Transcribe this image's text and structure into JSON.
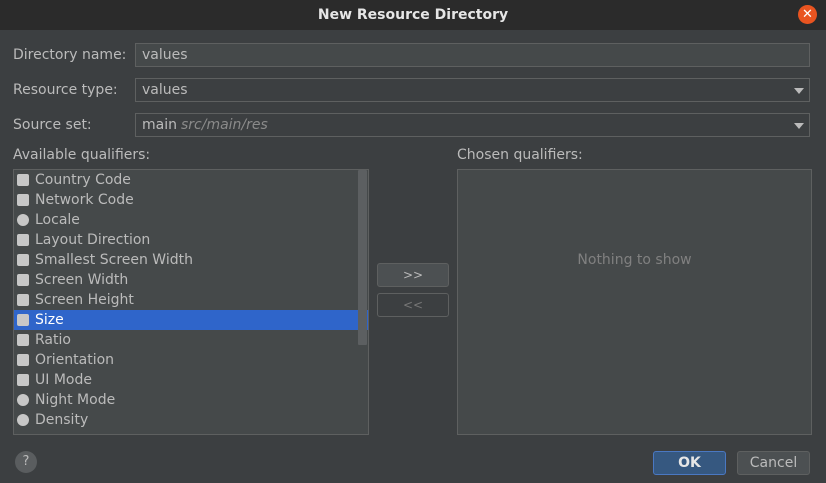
{
  "window": {
    "title": "New Resource Directory"
  },
  "form": {
    "directory_name": {
      "label": "Directory name:",
      "value": "values"
    },
    "resource_type": {
      "label": "Resource type:",
      "value": "values"
    },
    "source_set": {
      "label": "Source set:",
      "value": "main",
      "hint": "src/main/res"
    }
  },
  "available": {
    "label": "Available qualifiers:",
    "selected_index": 7,
    "items": [
      {
        "label": "Country Code",
        "icon": "country-code-icon"
      },
      {
        "label": "Network Code",
        "icon": "network-code-icon"
      },
      {
        "label": "Locale",
        "icon": "globe-icon"
      },
      {
        "label": "Layout Direction",
        "icon": "layout-direction-icon"
      },
      {
        "label": "Smallest Screen Width",
        "icon": "smallest-width-icon"
      },
      {
        "label": "Screen Width",
        "icon": "screen-width-icon"
      },
      {
        "label": "Screen Height",
        "icon": "screen-height-icon"
      },
      {
        "label": "Size",
        "icon": "size-icon"
      },
      {
        "label": "Ratio",
        "icon": "ratio-icon"
      },
      {
        "label": "Orientation",
        "icon": "orientation-icon"
      },
      {
        "label": "UI Mode",
        "icon": "ui-mode-icon"
      },
      {
        "label": "Night Mode",
        "icon": "night-mode-icon"
      },
      {
        "label": "Density",
        "icon": "density-icon"
      }
    ]
  },
  "chosen": {
    "label": "Chosen qualifiers:",
    "empty_text": "Nothing to show"
  },
  "buttons": {
    "add": ">>",
    "remove": "<<",
    "ok": "OK",
    "cancel": "Cancel",
    "help": "?"
  },
  "colors": {
    "selection": "#2f65ca",
    "close": "#e95420",
    "ok": "#365880"
  }
}
